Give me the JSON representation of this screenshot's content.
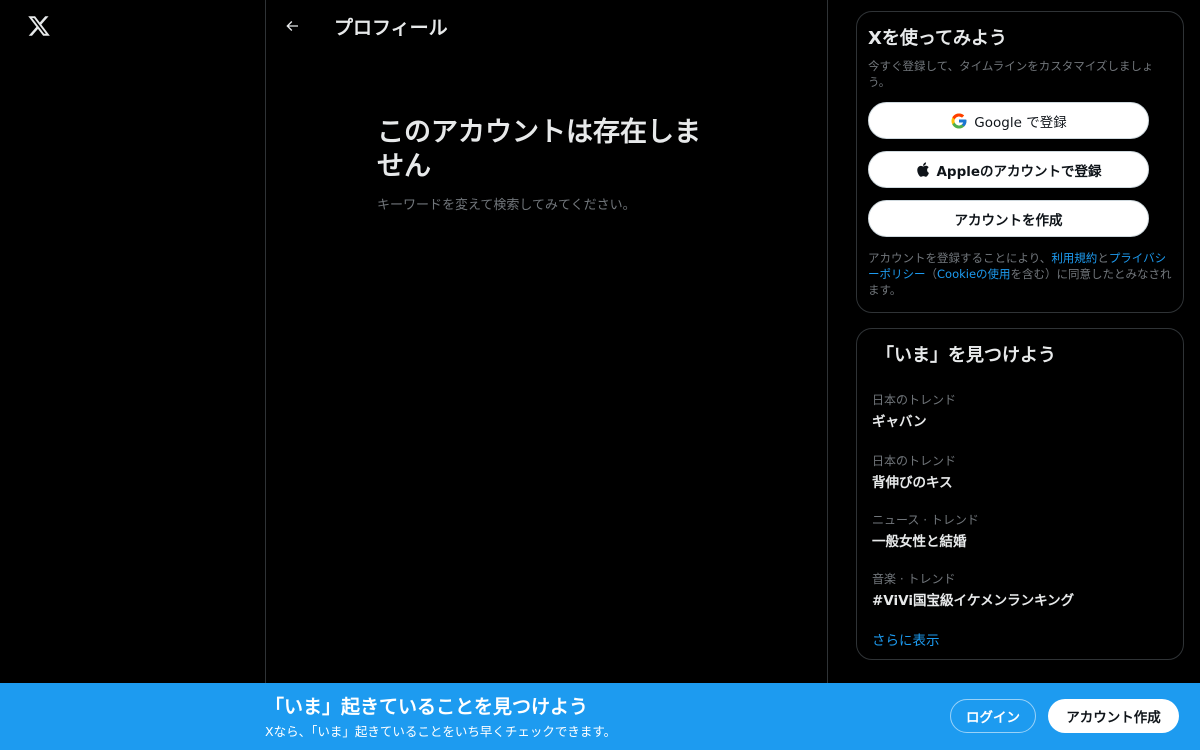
{
  "icons": {
    "logo": "x-logo-icon",
    "back": "arrow-left-icon",
    "google": "google-icon",
    "apple": "apple-icon"
  },
  "colors": {
    "background": "#000000",
    "accent": "#1d9bf0",
    "border": "#2f3336",
    "secondary_text": "#71767b"
  },
  "main": {
    "title": "プロフィール",
    "empty_title": "このアカウントは存在しません",
    "empty_subtitle": "キーワードを変えて検索してみてください。"
  },
  "signup_card": {
    "title": "Xを使ってみよう",
    "description": "今すぐ登録して、タイムラインをカスタマイズしましょう。",
    "google_label": "Google で登録",
    "apple_label": "Appleのアカウントで登録",
    "create_label": "アカウントを作成",
    "terms_prefix": "アカウントを登録することにより、",
    "terms_link": "利用規約",
    "terms_and": "と",
    "privacy_link": "プライバシーポリシー",
    "terms_paren_open": "（",
    "cookie_link": "Cookieの使用",
    "terms_suffix": "を含む）に同意したとみなされます。"
  },
  "trends_card": {
    "title": "「いま」を見つけよう",
    "items": [
      {
        "meta": "日本のトレンド",
        "name": "ギャバン"
      },
      {
        "meta": "日本のトレンド",
        "name": "背伸びのキス"
      },
      {
        "meta": "ニュース · トレンド",
        "name": "一般女性と結婚"
      },
      {
        "meta": "音楽 · トレンド",
        "name": "#ViVi国宝級イケメンランキング"
      }
    ],
    "show_more": "さらに表示"
  },
  "bottom_bar": {
    "title": "「いま」起きていることを見つけよう",
    "subtitle": "Xなら、「いま」起きていることをいち早くチェックできます。",
    "login_label": "ログイン",
    "signup_label": "アカウント作成"
  }
}
